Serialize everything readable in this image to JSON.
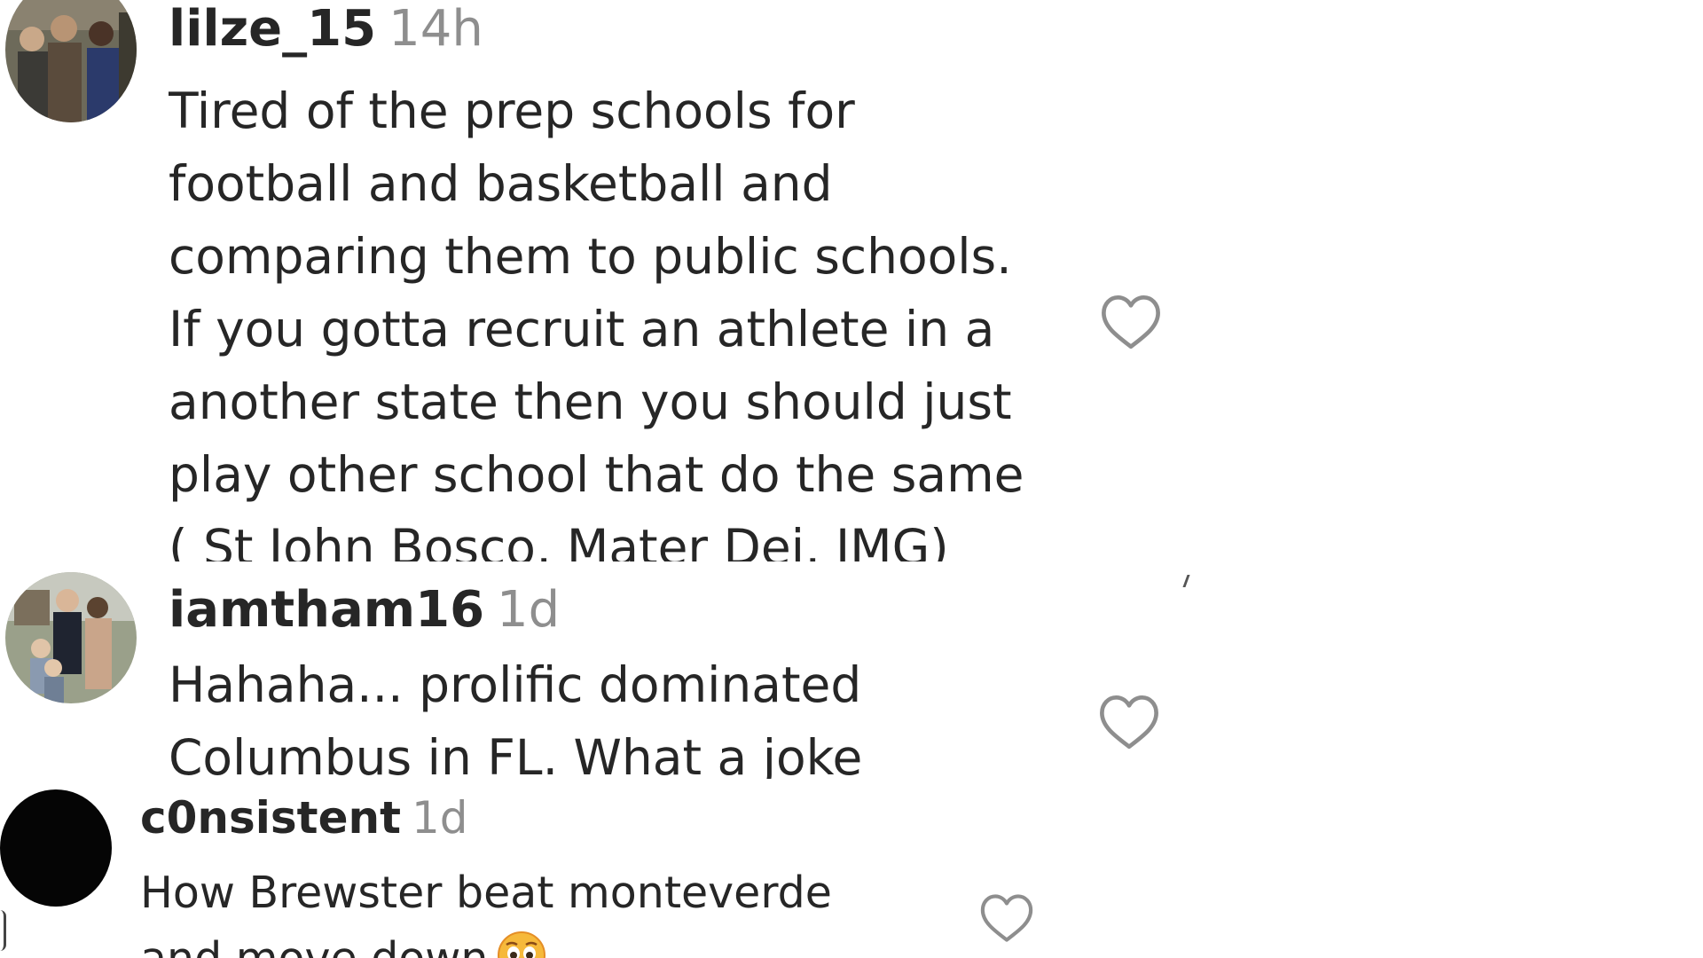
{
  "comments": [
    {
      "username": "lilze_15",
      "time": "14h",
      "text_lines": [
        "Tired of the prep schools for",
        "football and basketball and",
        "comparing them to public schools.",
        "If you gotta recruit an athlete in a",
        "another state then you should just",
        "play other school that do the same",
        "( St John Bosco, Mater Dei, IMG)"
      ],
      "avatar_icon": "group-photo-avatar",
      "like_icon": "heart-outline-icon"
    },
    {
      "username": "iamtham16",
      "time": "1d",
      "text_lines": [
        "Hahaha... prolific dominated",
        "Columbus in FL. What a joke"
      ],
      "avatar_icon": "family-photo-avatar",
      "like_icon": "heart-outline-icon"
    },
    {
      "username": "c0nsistent",
      "time": "1d",
      "text_lines": [
        "How Brewster beat monteverde",
        "and move down"
      ],
      "emoji": "pleading-face-emoji",
      "avatar_icon": "black-circle-avatar",
      "like_icon": "heart-outline-icon"
    }
  ],
  "colors": {
    "text": "#262626",
    "timestamp": "#8e8e8e",
    "like_icon": "#8e8e8e",
    "background": "#ffffff"
  }
}
